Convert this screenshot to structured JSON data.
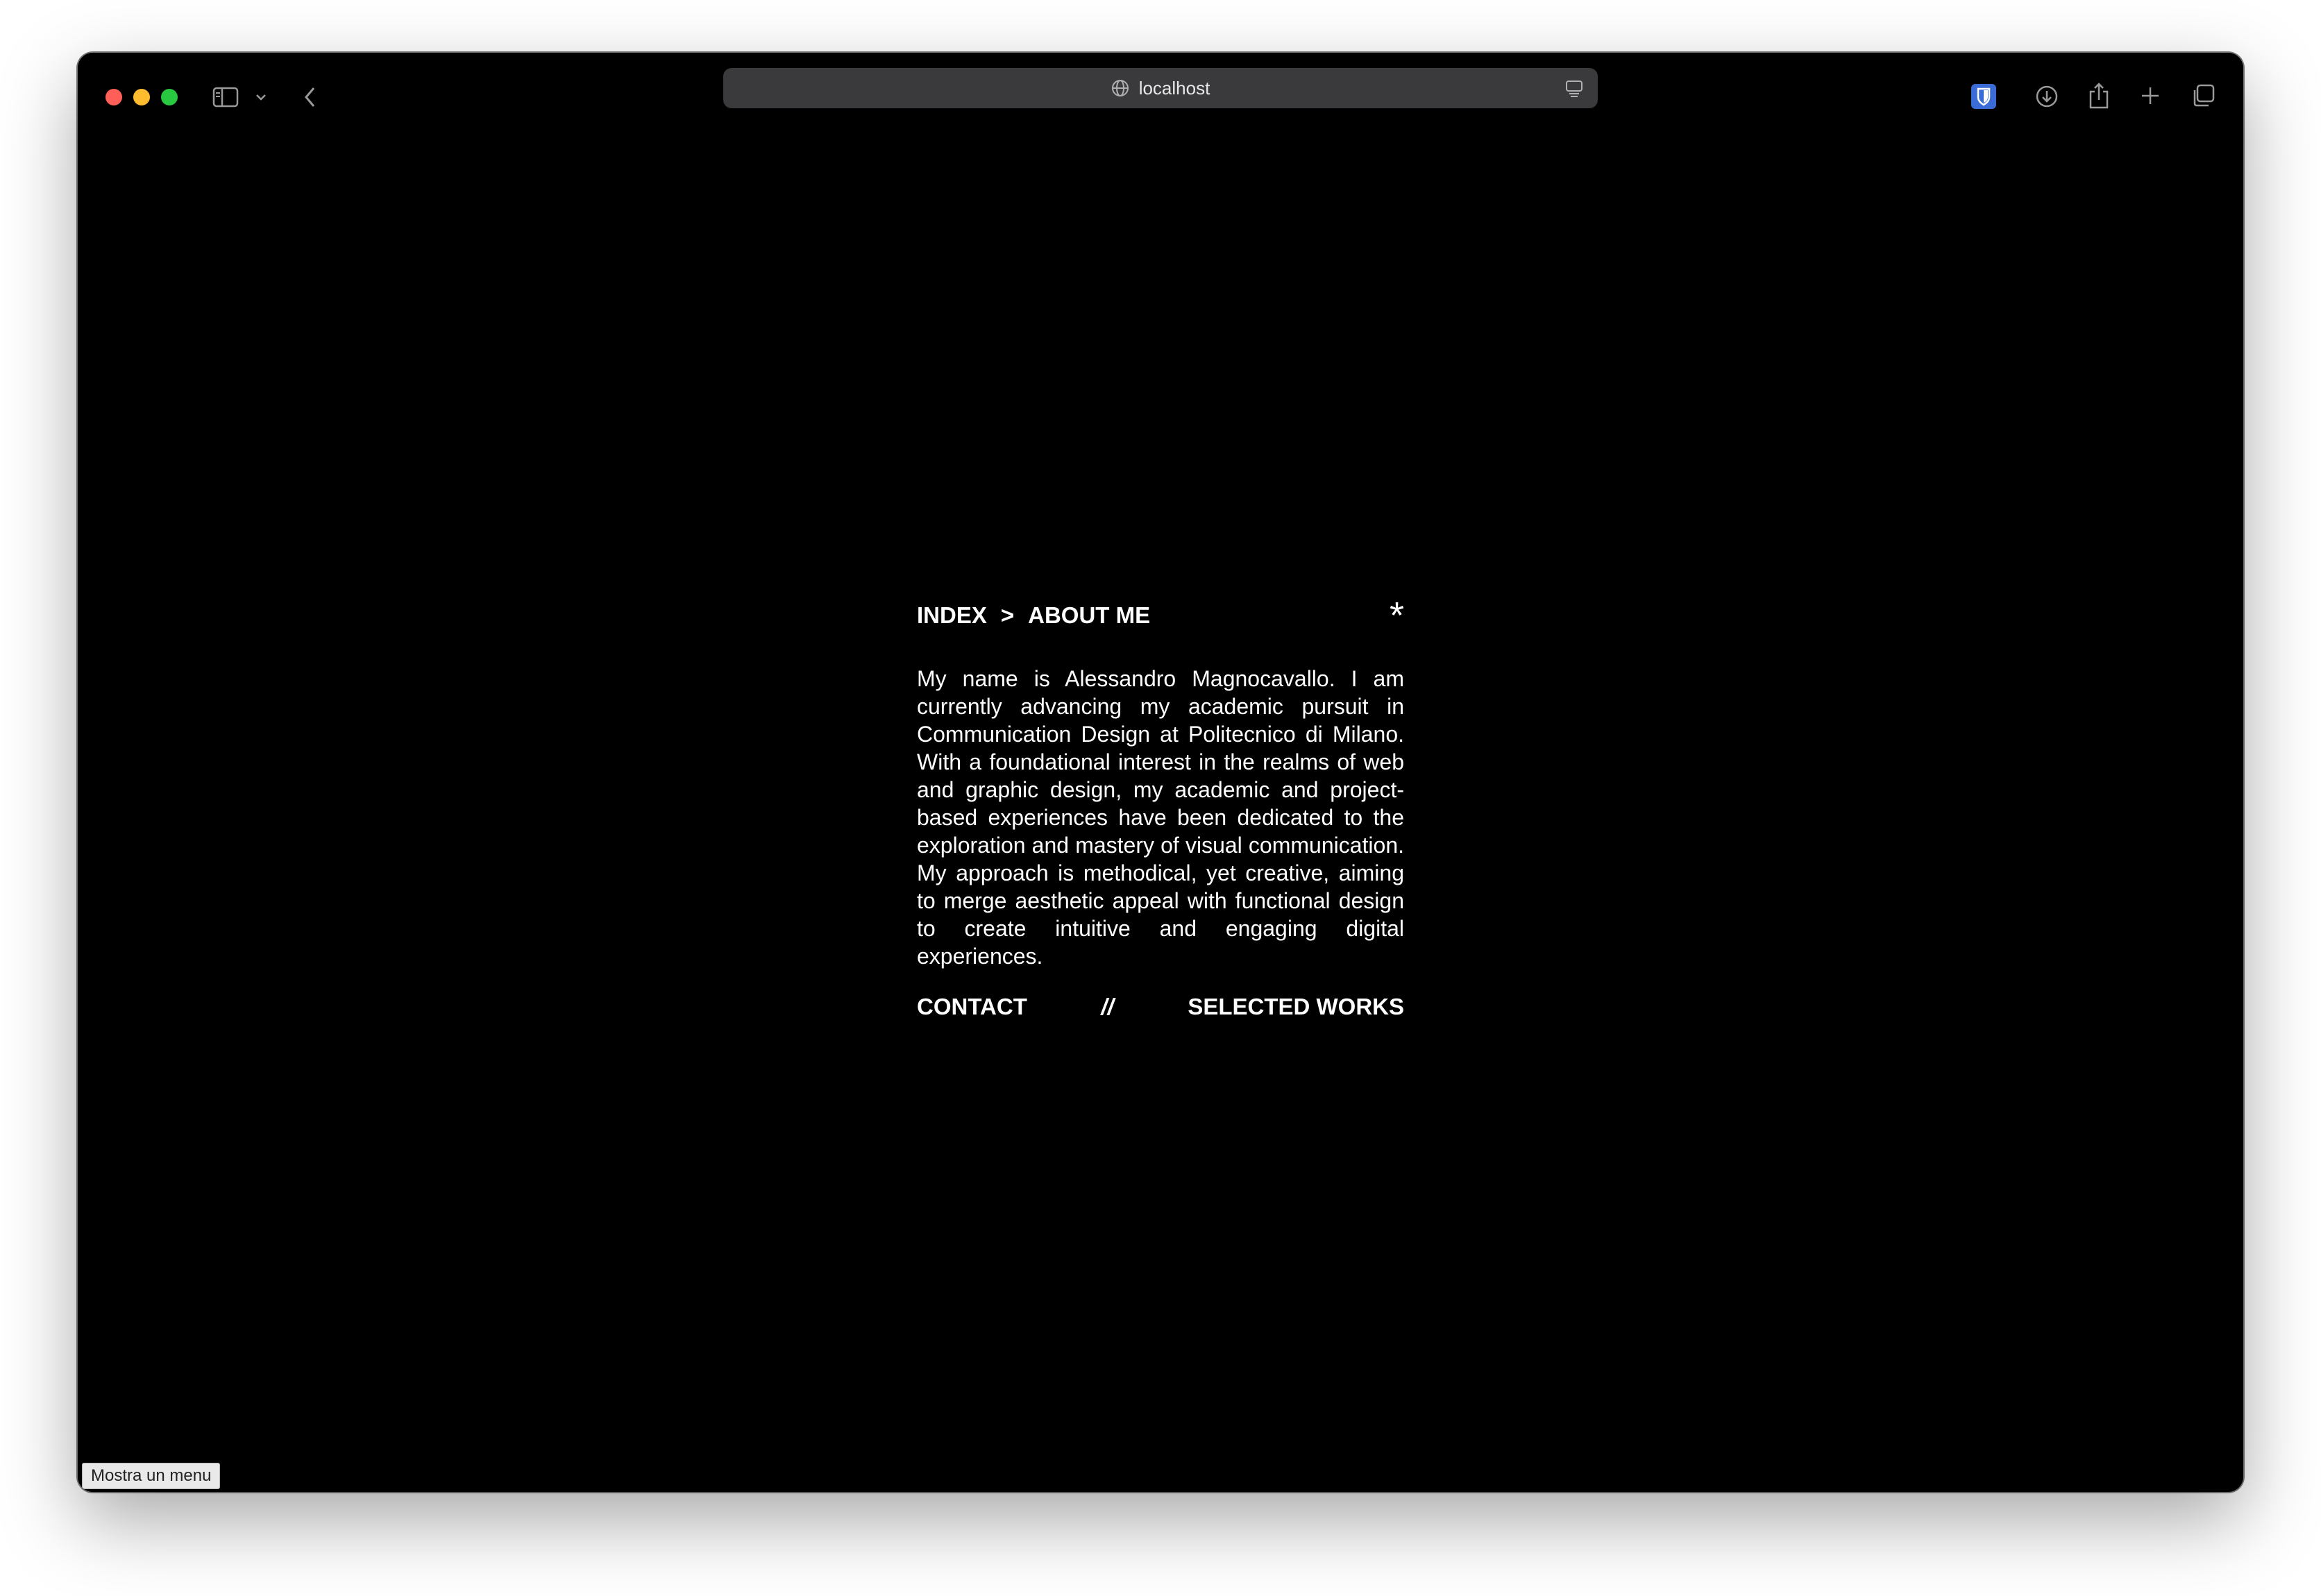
{
  "browser": {
    "url": "localhost",
    "icons": {
      "sidebar": "sidebar-icon",
      "chevron": "chevron-down-icon",
      "back": "back-arrow-icon",
      "globe": "globe-icon",
      "reader": "reader-icon",
      "extension": "bitwarden-shield-icon",
      "downloads": "download-icon",
      "share": "share-icon",
      "new_tab": "plus-icon",
      "tabs": "tabs-overview-icon"
    },
    "accent": "#3b6bd6"
  },
  "page": {
    "breadcrumb": {
      "root": "INDEX",
      "separator": ">",
      "current": "ABOUT ME"
    },
    "asterisk": "*",
    "bio": "My name is Alessandro Magnocavallo. I am currently advancing my academic pursuit in Communication Design at Politecnico di Milano. With a foundational interest in the realms of web and graphic design, my academic and project-based experiences have been dedicated to the exploration and mastery of visual communication. My approach is methodical, yet creative, aiming to merge aesthetic appeal with functional design to create intuitive and engaging digital experiences.",
    "links": {
      "contact": "CONTACT",
      "divider": "//",
      "works": "SELECTED WORKS"
    }
  },
  "status_tip": "Mostra un menu"
}
